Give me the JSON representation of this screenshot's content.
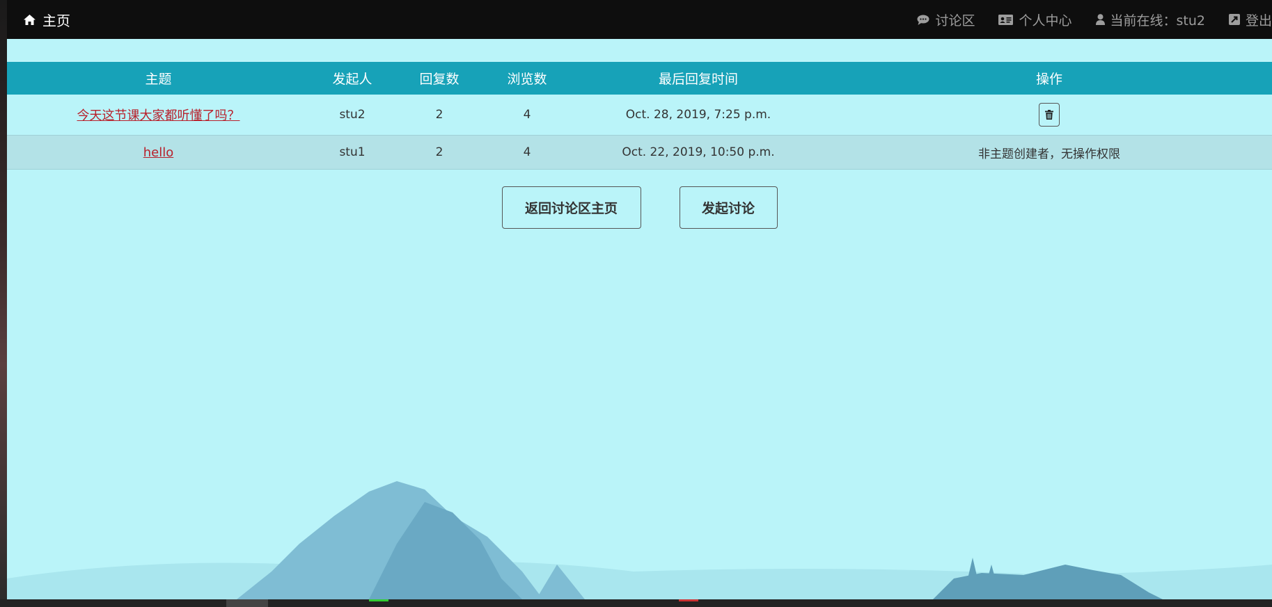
{
  "navbar": {
    "brand": "主页",
    "items": [
      {
        "label": "讨论区",
        "icon": "comment-icon"
      },
      {
        "label": "个人中心",
        "icon": "id-card-icon"
      },
      {
        "label": "当前在线：stu2",
        "icon": "user-icon"
      },
      {
        "label": "登出",
        "icon": "logout-icon"
      }
    ]
  },
  "table": {
    "headers": [
      "主题",
      "发起人",
      "回复数",
      "浏览数",
      "最后回复时间",
      "操作"
    ],
    "rows": [
      {
        "topic": "今天这节课大家都听懂了吗？",
        "author": "stu2",
        "replies": "2",
        "views": "4",
        "last_reply": "Oct. 28, 2019, 7:25 p.m.",
        "action": ""
      },
      {
        "topic": "hello",
        "author": "stu1",
        "replies": "2",
        "views": "4",
        "last_reply": "Oct. 22, 2019, 10:50 p.m.",
        "action": "非主题创建者，无操作权限"
      }
    ]
  },
  "buttons": {
    "back": "返回讨论区主页",
    "new": "发起讨论"
  },
  "colors": {
    "navbar_bg": "#0e0e0e",
    "page_bg": "#baf4f9",
    "header_bg": "#17a2b8",
    "link": "#b8202b"
  }
}
